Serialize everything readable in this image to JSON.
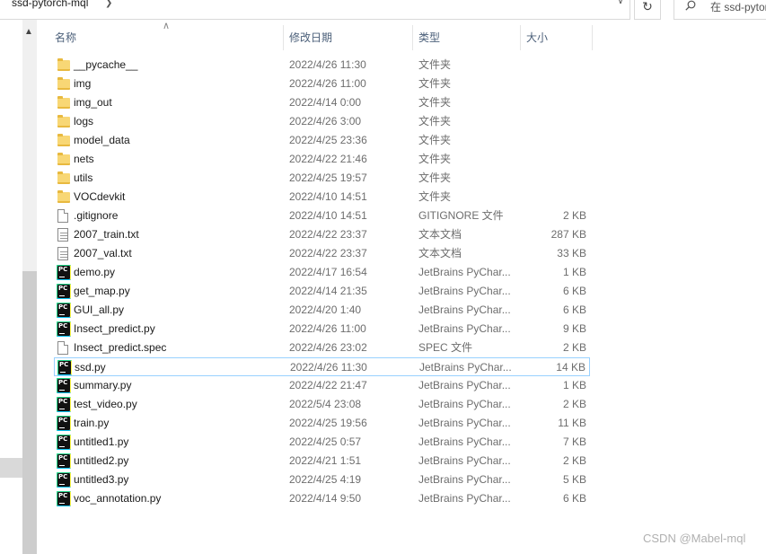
{
  "address_bar": {
    "path": "ssd-pytorch-mql"
  },
  "search": {
    "placeholder": "在 ssd-pytorch-mql"
  },
  "columns": {
    "name": "名称",
    "date": "修改日期",
    "type": "类型",
    "size": "大小"
  },
  "files": [
    {
      "name": "__pycache__",
      "date": "2022/4/26 11:30",
      "type": "文件夹",
      "size": "",
      "icon": "folder-icon"
    },
    {
      "name": "img",
      "date": "2022/4/26 11:00",
      "type": "文件夹",
      "size": "",
      "icon": "folder-icon"
    },
    {
      "name": "img_out",
      "date": "2022/4/14 0:00",
      "type": "文件夹",
      "size": "",
      "icon": "folder-icon"
    },
    {
      "name": "logs",
      "date": "2022/4/26 3:00",
      "type": "文件夹",
      "size": "",
      "icon": "folder-icon"
    },
    {
      "name": "model_data",
      "date": "2022/4/25 23:36",
      "type": "文件夹",
      "size": "",
      "icon": "folder-icon"
    },
    {
      "name": "nets",
      "date": "2022/4/22 21:46",
      "type": "文件夹",
      "size": "",
      "icon": "folder-icon"
    },
    {
      "name": "utils",
      "date": "2022/4/25 19:57",
      "type": "文件夹",
      "size": "",
      "icon": "folder-icon"
    },
    {
      "name": "VOCdevkit",
      "date": "2022/4/10 14:51",
      "type": "文件夹",
      "size": "",
      "icon": "folder-icon"
    },
    {
      "name": ".gitignore",
      "date": "2022/4/10 14:51",
      "type": "GITIGNORE 文件",
      "size": "2 KB",
      "icon": "file-icon"
    },
    {
      "name": "2007_train.txt",
      "date": "2022/4/22 23:37",
      "type": "文本文档",
      "size": "287 KB",
      "icon": "text-file-icon"
    },
    {
      "name": "2007_val.txt",
      "date": "2022/4/22 23:37",
      "type": "文本文档",
      "size": "33 KB",
      "icon": "text-file-icon"
    },
    {
      "name": "demo.py",
      "date": "2022/4/17 16:54",
      "type": "JetBrains PyChar...",
      "size": "1 KB",
      "icon": "pycharm-icon"
    },
    {
      "name": "get_map.py",
      "date": "2022/4/14 21:35",
      "type": "JetBrains PyChar...",
      "size": "6 KB",
      "icon": "pycharm-icon"
    },
    {
      "name": "GUI_all.py",
      "date": "2022/4/20 1:40",
      "type": "JetBrains PyChar...",
      "size": "6 KB",
      "icon": "pycharm-icon"
    },
    {
      "name": "Insect_predict.py",
      "date": "2022/4/26 11:00",
      "type": "JetBrains PyChar...",
      "size": "9 KB",
      "icon": "pycharm-icon"
    },
    {
      "name": "Insect_predict.spec",
      "date": "2022/4/26 23:02",
      "type": "SPEC 文件",
      "size": "2 KB",
      "icon": "file-icon"
    },
    {
      "name": "ssd.py",
      "date": "2022/4/26 11:30",
      "type": "JetBrains PyChar...",
      "size": "14 KB",
      "icon": "pycharm-icon",
      "selected": true
    },
    {
      "name": "summary.py",
      "date": "2022/4/22 21:47",
      "type": "JetBrains PyChar...",
      "size": "1 KB",
      "icon": "pycharm-icon"
    },
    {
      "name": "test_video.py",
      "date": "2022/5/4 23:08",
      "type": "JetBrains PyChar...",
      "size": "2 KB",
      "icon": "pycharm-icon"
    },
    {
      "name": "train.py",
      "date": "2022/4/25 19:56",
      "type": "JetBrains PyChar...",
      "size": "11 KB",
      "icon": "pycharm-icon"
    },
    {
      "name": "untitled1.py",
      "date": "2022/4/25 0:57",
      "type": "JetBrains PyChar...",
      "size": "7 KB",
      "icon": "pycharm-icon"
    },
    {
      "name": "untitled2.py",
      "date": "2022/4/21 1:51",
      "type": "JetBrains PyChar...",
      "size": "2 KB",
      "icon": "pycharm-icon"
    },
    {
      "name": "untitled3.py",
      "date": "2022/4/25 4:19",
      "type": "JetBrains PyChar...",
      "size": "5 KB",
      "icon": "pycharm-icon"
    },
    {
      "name": "voc_annotation.py",
      "date": "2022/4/14 9:50",
      "type": "JetBrains PyChar...",
      "size": "6 KB",
      "icon": "pycharm-icon"
    }
  ],
  "watermark": "CSDN @Mabel-mql",
  "colors": {
    "folder": "#f8d775",
    "selection_border": "#99d1ff",
    "header_text": "#4c607a",
    "secondary_text": "#6d6d6d"
  }
}
